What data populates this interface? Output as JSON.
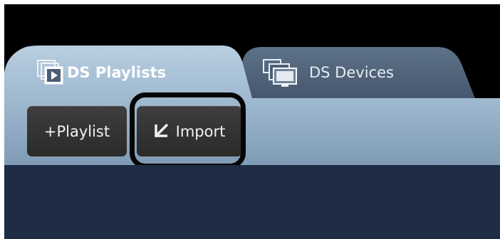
{
  "tabs": [
    {
      "label": "DS Playlists",
      "icon": "playlists-icon",
      "active": true
    },
    {
      "label": "DS Devices",
      "icon": "devices-icon",
      "active": false
    }
  ],
  "toolbar": {
    "add_playlist_label": "+Playlist",
    "import_label": "Import",
    "import_icon": "import-arrow-icon"
  },
  "colors": {
    "background": "#000000",
    "active_tab_top": "#a4bed6",
    "inactive_tab": "#4b5f75",
    "content_area": "#1e2d45",
    "button": "#3a3836",
    "highlight_ring": "#050505"
  }
}
